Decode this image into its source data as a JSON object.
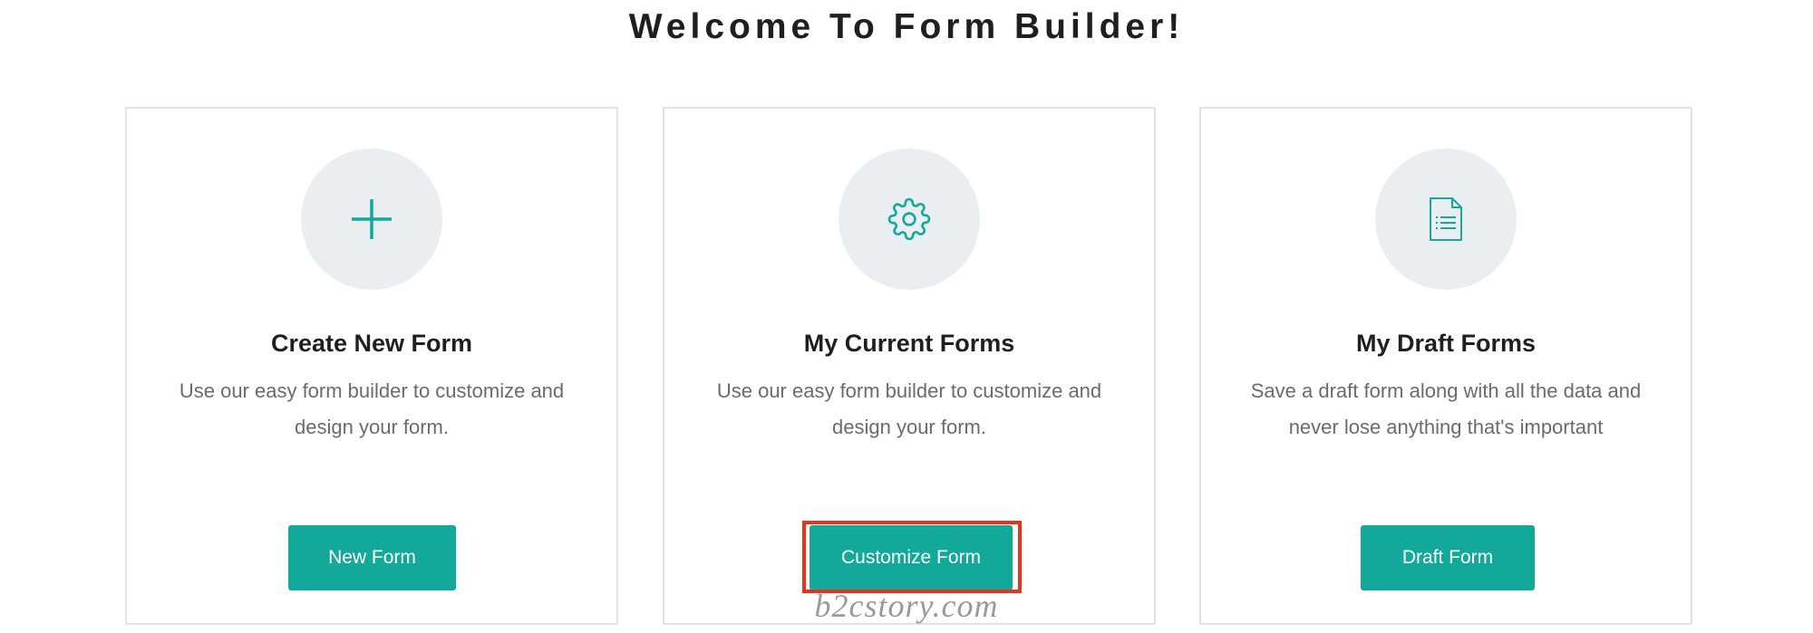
{
  "page": {
    "title": "Welcome To Form Builder!"
  },
  "colors": {
    "accent": "#12a89a",
    "icon_bg": "#ebeef0",
    "highlight": "#e8321e"
  },
  "cards": [
    {
      "icon": "plus-icon",
      "title": "Create New Form",
      "description": "Use our easy form builder to customize and design your form.",
      "button_label": "New Form"
    },
    {
      "icon": "gear-icon",
      "title": "My Current Forms",
      "description": "Use our easy form builder to customize and design your form.",
      "button_label": "Customize Form"
    },
    {
      "icon": "document-icon",
      "title": "My Draft Forms",
      "description": "Save a draft form along with all the data and never lose anything that's important",
      "button_label": "Draft Form"
    }
  ],
  "watermark": "b2cstory.com"
}
